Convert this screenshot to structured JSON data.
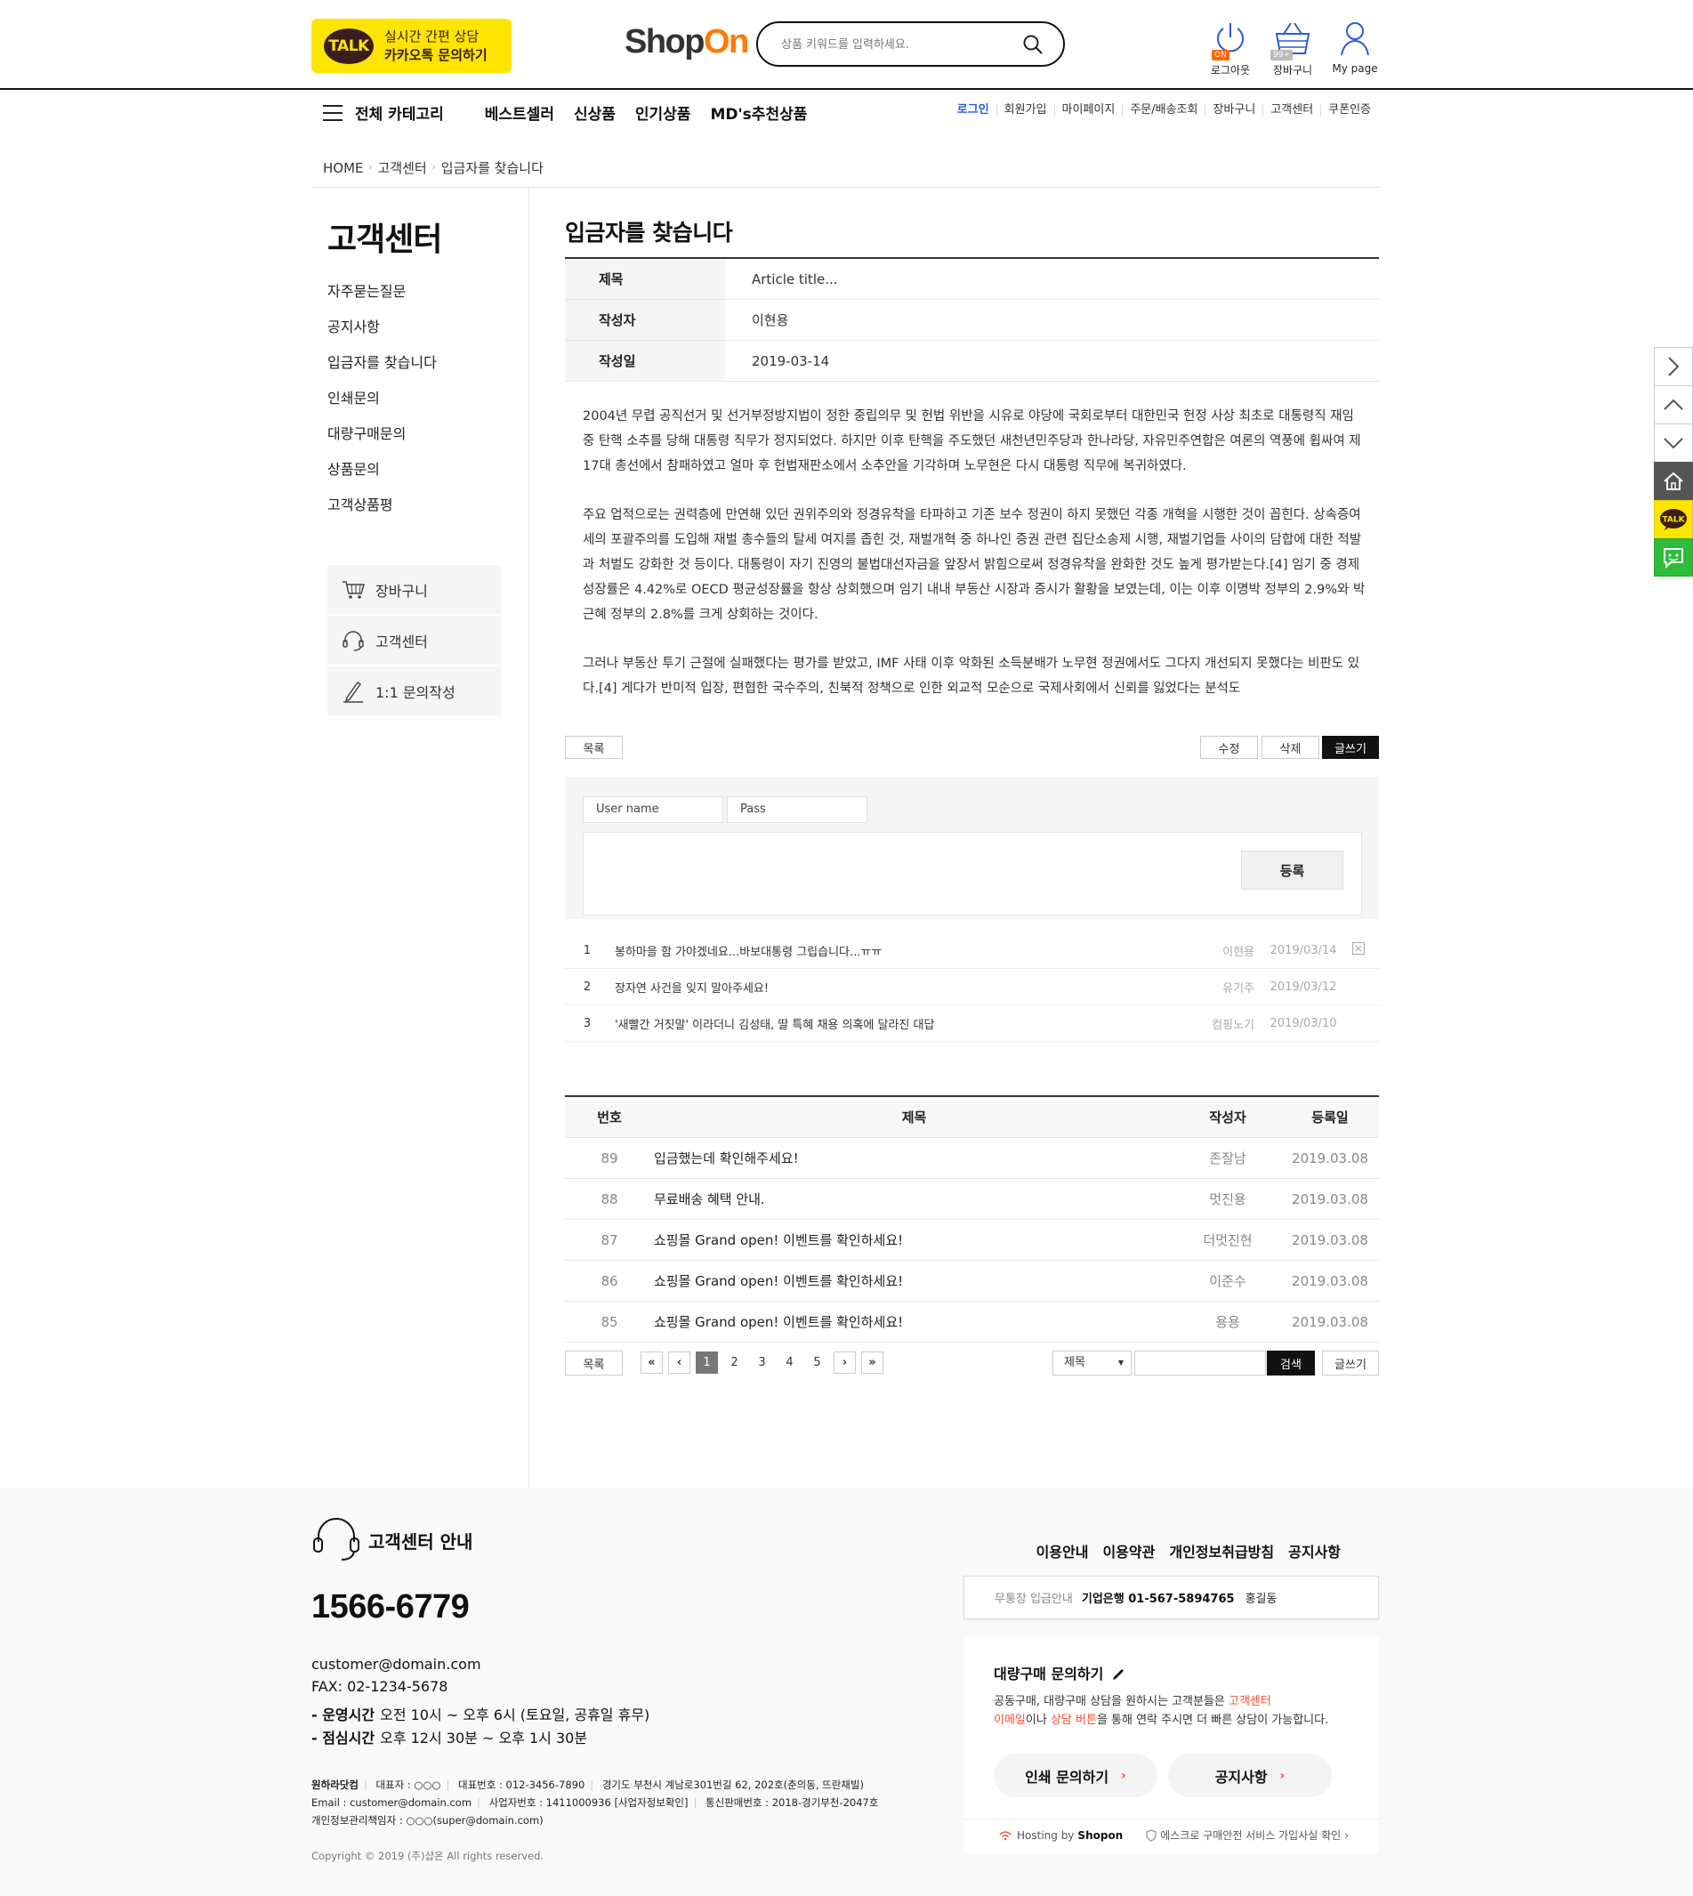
{
  "header": {
    "talk_line1": "실시간 간편 상담",
    "talk_line2": "카카오톡 문의하기",
    "talk_badge": "TALK",
    "logo_shop": "Shop",
    "logo_on": "On",
    "search_placeholder": "상품 키워드를 입력하세요.",
    "icons": [
      {
        "label": "로그아웃",
        "badge": "ON"
      },
      {
        "label": "장바구니",
        "badge": "99+"
      },
      {
        "label": "My page"
      }
    ]
  },
  "nav": {
    "all_category": "전체 카테고리",
    "main": [
      "베스트셀러",
      "신상품",
      "인기상품",
      "MD's추천상품"
    ],
    "util": [
      "로그인",
      "회원가입",
      "마이페이지",
      "주문/배송조회",
      "장바구니",
      "고객센터",
      "쿠폰인증"
    ]
  },
  "breadcrumb": [
    "HOME",
    "고객센터",
    "입금자를 찾습니다"
  ],
  "sidebar": {
    "title": "고객센터",
    "menu": [
      "자주묻는질문",
      "공지사항",
      "입금자를 찾습니다",
      "인쇄문의",
      "대량구매문의",
      "상품문의",
      "고객상품평"
    ],
    "box": [
      "장바구니",
      "고객센터",
      "1:1 문의작성"
    ]
  },
  "article": {
    "title": "입금자를 찾습니다",
    "meta": [
      {
        "key": "제목",
        "value": "Article title..."
      },
      {
        "key": "작성자",
        "value": "이현용"
      },
      {
        "key": "작성일",
        "value": "2019-03-14"
      }
    ],
    "paragraphs": [
      "2004년 무렵 공직선거 및 선거부정방지법이 정한 중립의무 및 헌법 위반을 시유로 야당에 국회로부터 대한민국 헌정 사상 최초로 대통령직 재임 중 탄핵 소추를 당해 대통령 직무가 정지되었다. 하지만 이후 탄핵을 주도했던 새천년민주당과 한나라당, 자유민주연합은 여론의 역풍에 휩싸여 제17대 총선에서 참패하였고 얼마 후 헌법재판소에서 소추안을 기각하며 노무현은 다시 대통령 직무에 복귀하였다.",
      "주요 업적으로는 권력층에 만연해 있던 권위주의와 정경유착을 타파하고 기존 보수 정권이 하지 못했던 각종 개혁을 시행한 것이 꼽힌다. 상속증여세의 포괄주의를 도입해 재벌 총수들의 탈세 여지를 좁힌 것, 재벌개혁 중 하나인 증권 관련 집단소송제 시행, 재벌기업들 사이의 담합에 대한 적발과 처벌도 강화한 것 등이다. 대통령이 자기 진영의 불법대선자금을 앞장서 밝힘으로써 정경유착을 완화한 것도 높게 평가받는다.[4] 임기 중 경제성장률은 4.42%로 OECD 평균성장률을 항상 상회했으며 임기 내내 부동산 시장과 증시가 활황을 보였는데, 이는 이후 이명박 정부의 2.9%와 박근혜 정부의 2.8%를 크게 상회하는 것이다.",
      "그러나 부동산 투기 근절에 실패했다는 평가를 받았고, IMF 사태 이후 악화된 소득분배가 노무현 정권에서도 그다지 개선되지 못했다는 비판도 있다.[4] 게다가 반미적 입장, 편협한 국수주의, 친북적 정책으로 인한 외교적 모순으로 국제사회에서 신뢰를 잃었다는 분석도"
    ],
    "btn_list": "목록",
    "btn_edit": "수정",
    "btn_delete": "삭제",
    "btn_write": "글쓰기"
  },
  "comment": {
    "username_placeholder": "User name",
    "pass_placeholder": "Pass",
    "submit": "등록",
    "rows": [
      {
        "no": "1",
        "text": "봉하마을 함 가야겠네요...바보대통령 그립습니다...ㅠㅠ",
        "author": "이현용",
        "date": "2019/03/14"
      },
      {
        "no": "2",
        "text": "장자연 사건을 잊지 말아주세요!",
        "author": "유기주",
        "date": "2019/03/12"
      },
      {
        "no": "3",
        "text": "'새빨간 거짓말' 이라더니 김성태, 딸 특혜 채용 의혹에 달라진 대답",
        "author": "컴핑노기",
        "date": "2019/03/10"
      }
    ]
  },
  "board": {
    "headers": {
      "no": "번호",
      "title": "제목",
      "author": "작성자",
      "date": "등록일"
    },
    "rows": [
      {
        "no": "89",
        "title": "입금했는데 확인해주세요!",
        "author": "존잘남",
        "date": "2019.03.08"
      },
      {
        "no": "88",
        "title": "무료배송 혜택 안내.",
        "author": "멋진용",
        "date": "2019.03.08"
      },
      {
        "no": "87",
        "title": "쇼핑몰 Grand open! 이벤트를 확인하세요!",
        "author": "더멋진현",
        "date": "2019.03.08"
      },
      {
        "no": "86",
        "title": "쇼핑몰 Grand open! 이벤트를 확인하세요!",
        "author": "이준수",
        "date": "2019.03.08"
      },
      {
        "no": "85",
        "title": "쇼핑몰 Grand open! 이벤트를 확인하세요!",
        "author": "용용",
        "date": "2019.03.08"
      }
    ],
    "btn_list": "목록",
    "pages": [
      "1",
      "2",
      "3",
      "4",
      "5"
    ],
    "current_page": "1",
    "search_field": "제목",
    "btn_search": "검색",
    "btn_write": "글쓰기"
  },
  "footer": {
    "cs_title": "고객센터 안내",
    "phone": "1566-6779",
    "email": "customer@domain.com",
    "fax": "FAX: 02-1234-5678",
    "hours_label": "- 운영시간",
    "hours_value": "오전 10시 ~ 오후 6시 (토요일, 공휴일 휴무)",
    "lunch_label": "- 점심시간",
    "lunch_value": "오후 12시 30분 ~ 오후 1시 30분",
    "company_line1": [
      "원하라닷컴",
      "대표자 : ○○○",
      "대표번호 : 012-3456-7890",
      "경기도 부천시 계남로301번길 62, 202호(춘의동, 뜨란채빌)"
    ],
    "company_line2": [
      "Email : customer@domain.com",
      "사업자번호 : 1411000936 [사업자정보확인]",
      "통신판매번호 : 2018-경기부천-2047호"
    ],
    "company_line3": "개인정보관리책임자 : ○○○(super@domain.com)",
    "copyright": "Copyright © 2019 (주)샵온 All rights reserved.",
    "links": [
      "이용안내",
      "이용약관",
      "개인정보취급방침",
      "공지사항"
    ],
    "bank_label": "무통장 입금안내",
    "bank_value": "기업은행 01-567-5894765",
    "bank_holder": "홍길동",
    "bulk_title": "대량구매 문의하기",
    "bulk_desc_1": "공동구매, 대량구매 상담을 원하시는 고객분들은 ",
    "bulk_desc_red1": "고객센터",
    "bulk_desc_red2": "이메일",
    "bulk_desc_2": "이나 ",
    "bulk_desc_red3": "상담 버튼",
    "bulk_desc_3": "을 통해 연락 주시면 더 빠른 상담이 가능합니다.",
    "pill_print": "인쇄 문의하기",
    "pill_notice": "공지사항",
    "host_text": "Hosting by",
    "host_brand": "Shopon",
    "escrow": "에스크로 구매안전 서비스 가입사실 확인"
  },
  "colors": {
    "accent_orange": "#ff7a00",
    "kakao_yellow": "#fee500",
    "link_blue": "#2a5bd7",
    "red": "#ff4b2b"
  }
}
